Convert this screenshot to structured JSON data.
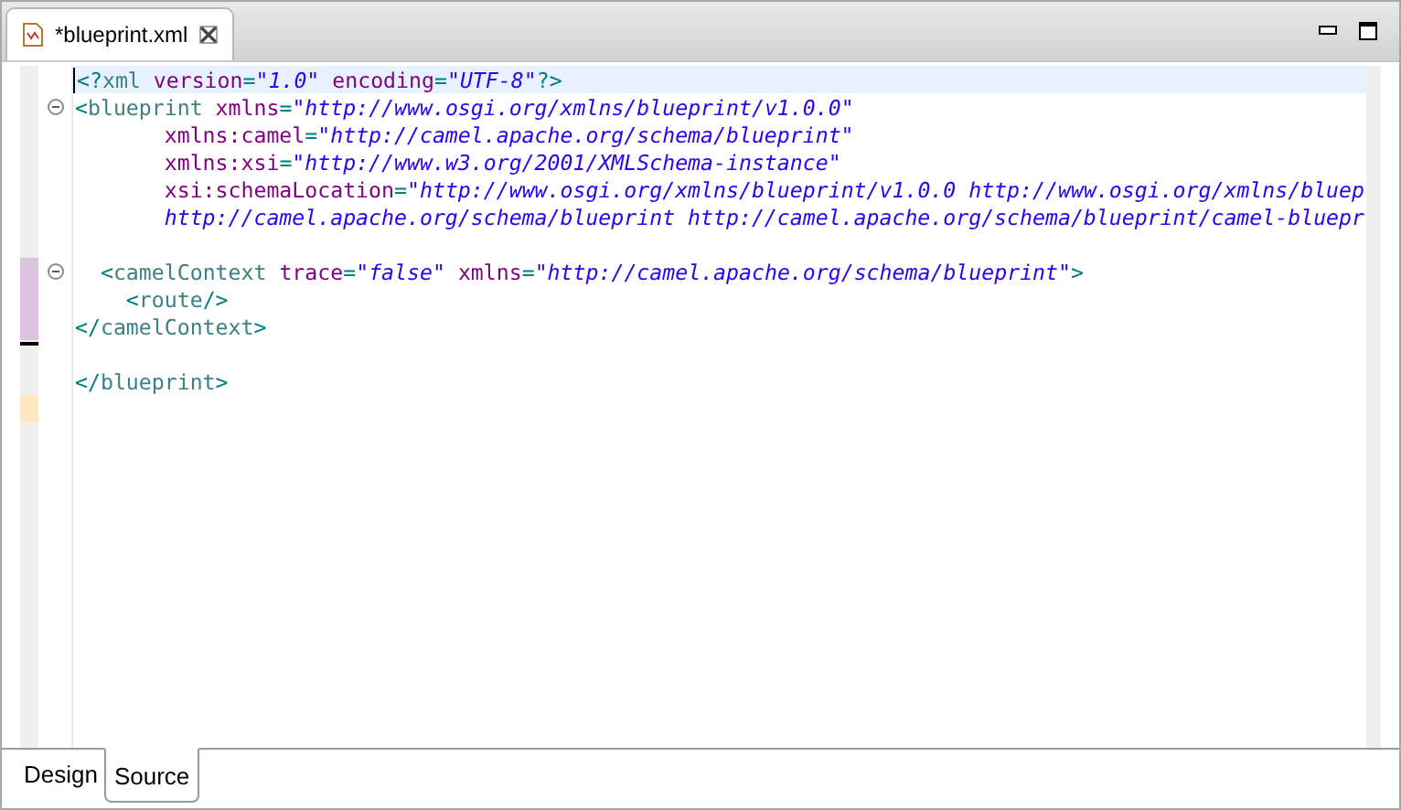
{
  "editor_tab": {
    "title": "*blueprint.xml"
  },
  "code_lines": [
    {
      "current": true,
      "foldable": false,
      "changed": false,
      "deleted": false,
      "added": false,
      "tokens": [
        {
          "kind": "punct",
          "text": "<?"
        },
        {
          "kind": "tag",
          "text": "xml "
        },
        {
          "kind": "attr",
          "text": "version"
        },
        {
          "kind": "punct",
          "text": "="
        },
        {
          "kind": "value",
          "text": "\"1.0\" "
        },
        {
          "kind": "attr",
          "text": "encoding"
        },
        {
          "kind": "punct",
          "text": "="
        },
        {
          "kind": "value",
          "text": "\"UTF-8\""
        },
        {
          "kind": "punct",
          "text": "?>"
        }
      ]
    },
    {
      "current": false,
      "foldable": true,
      "changed": false,
      "deleted": false,
      "added": false,
      "tokens": [
        {
          "kind": "punct",
          "text": "<"
        },
        {
          "kind": "tag",
          "text": "blueprint "
        },
        {
          "kind": "attr",
          "text": "xmlns"
        },
        {
          "kind": "punct",
          "text": "="
        },
        {
          "kind": "value",
          "text": "\"http://www.osgi.org/xmlns/blueprint/v1.0.0\""
        }
      ]
    },
    {
      "current": false,
      "foldable": false,
      "changed": false,
      "deleted": false,
      "added": false,
      "tokens": [
        {
          "kind": "attr",
          "text": "       xmlns:camel"
        },
        {
          "kind": "punct",
          "text": "="
        },
        {
          "kind": "value",
          "text": "\"http://camel.apache.org/schema/blueprint\""
        }
      ]
    },
    {
      "current": false,
      "foldable": false,
      "changed": false,
      "deleted": false,
      "added": false,
      "tokens": [
        {
          "kind": "attr",
          "text": "       xmlns:xsi"
        },
        {
          "kind": "punct",
          "text": "="
        },
        {
          "kind": "value",
          "text": "\"http://www.w3.org/2001/XMLSchema-instance\""
        }
      ]
    },
    {
      "current": false,
      "foldable": false,
      "changed": false,
      "deleted": false,
      "added": false,
      "tokens": [
        {
          "kind": "attr",
          "text": "       xsi:schemaLocation"
        },
        {
          "kind": "punct",
          "text": "="
        },
        {
          "kind": "value",
          "text": "\"http://www.osgi.org/xmlns/blueprint/v1.0.0 http://www.osgi.org/xmlns/bluep"
        }
      ]
    },
    {
      "current": false,
      "foldable": false,
      "changed": false,
      "deleted": false,
      "added": false,
      "tokens": [
        {
          "kind": "value",
          "text": "       http://camel.apache.org/schema/blueprint http://camel.apache.org/schema/blueprint/camel-bluepr"
        }
      ]
    },
    {
      "current": false,
      "foldable": false,
      "changed": false,
      "deleted": false,
      "added": false
    },
    {
      "current": false,
      "foldable": true,
      "changed": true,
      "deleted": false,
      "added": false,
      "tokens": [
        {
          "kind": "punct",
          "text": "  <"
        },
        {
          "kind": "tag",
          "text": "camelContext "
        },
        {
          "kind": "attr",
          "text": "trace"
        },
        {
          "kind": "punct",
          "text": "="
        },
        {
          "kind": "value",
          "text": "\"false\" "
        },
        {
          "kind": "attr",
          "text": "xmlns"
        },
        {
          "kind": "punct",
          "text": "="
        },
        {
          "kind": "value",
          "text": "\"http://camel.apache.org/schema/blueprint\""
        },
        {
          "kind": "punct",
          "text": ">"
        }
      ]
    },
    {
      "current": false,
      "foldable": false,
      "changed": true,
      "deleted": false,
      "added": false,
      "tokens": [
        {
          "kind": "punct",
          "text": "    <"
        },
        {
          "kind": "tag",
          "text": "route"
        },
        {
          "kind": "punct",
          "text": "/>"
        }
      ]
    },
    {
      "current": false,
      "foldable": false,
      "changed": true,
      "deleted": false,
      "added": false,
      "tokens": [
        {
          "kind": "punct",
          "text": "</"
        },
        {
          "kind": "tag",
          "text": "camelContext"
        },
        {
          "kind": "punct",
          "text": ">"
        }
      ]
    },
    {
      "current": false,
      "foldable": false,
      "changed": false,
      "deleted": true,
      "added": false
    },
    {
      "current": false,
      "foldable": false,
      "changed": false,
      "deleted": false,
      "added": false,
      "tokens": [
        {
          "kind": "punct",
          "text": "</"
        },
        {
          "kind": "tag",
          "text": "blueprint"
        },
        {
          "kind": "punct",
          "text": ">"
        }
      ]
    },
    {
      "current": false,
      "foldable": false,
      "changed": false,
      "deleted": false,
      "added": true
    }
  ],
  "bottom_tabs": [
    {
      "label": "Design",
      "selected": false
    },
    {
      "label": "Source",
      "selected": true
    }
  ]
}
